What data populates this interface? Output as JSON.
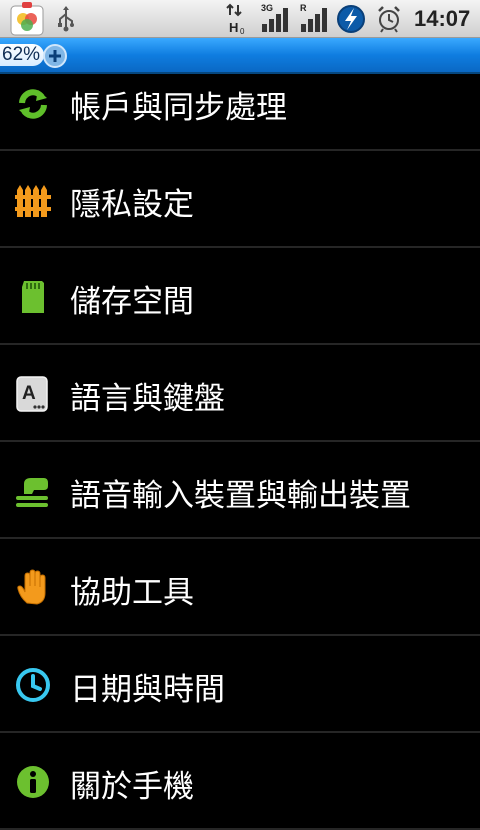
{
  "status_bar": {
    "time": "14:07",
    "network_labels": {
      "h": "H",
      "3g": "3G",
      "r": "R"
    },
    "icons": [
      "app-icon",
      "usb-icon",
      "h-data-icon",
      "signal-3g-icon",
      "signal-roaming-icon",
      "battery-charging-icon",
      "alarm-icon"
    ]
  },
  "notification": {
    "percent": "62%"
  },
  "settings": {
    "items": [
      {
        "label": "帳戶與同步處理",
        "icon": "sync-icon"
      },
      {
        "label": "隱私設定",
        "icon": "privacy-fence-icon"
      },
      {
        "label": "儲存空間",
        "icon": "sd-card-icon"
      },
      {
        "label": "語言與鍵盤",
        "icon": "keyboard-a-icon"
      },
      {
        "label": "語音輸入裝置與輸出裝置",
        "icon": "voice-io-icon"
      },
      {
        "label": "協助工具",
        "icon": "hand-icon"
      },
      {
        "label": "日期與時間",
        "icon": "clock-icon"
      },
      {
        "label": "關於手機",
        "icon": "info-icon"
      }
    ]
  },
  "colors": {
    "notify_blue": "#1083e6",
    "sync_green": "#5fbf2a",
    "privacy_orange": "#f39a1c",
    "clock_cyan": "#38c8f0"
  }
}
